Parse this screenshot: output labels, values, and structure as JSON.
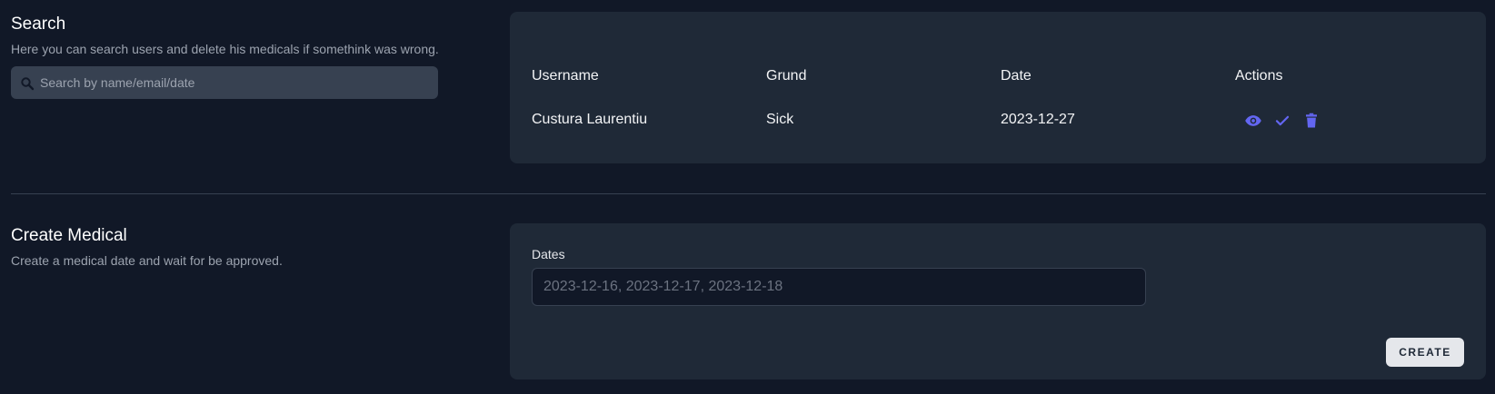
{
  "search_section": {
    "title": "Search",
    "description": "Here you can search users and delete his medicals if somethink was wrong.",
    "search_placeholder": "Search by name/email/date",
    "search_icon": "search-icon"
  },
  "table": {
    "headers": [
      "Username",
      "Grund",
      "Date",
      "Actions"
    ],
    "rows": [
      {
        "username": "Custura Laurentiu",
        "grund": "Sick",
        "date": "2023-12-27"
      }
    ],
    "action_icons": [
      "eye-icon",
      "check-icon",
      "trash-icon"
    ],
    "action_color": "#6366f1"
  },
  "create_section": {
    "title": "Create Medical",
    "description": "Create a medical date and wait for be approved.",
    "dates_label": "Dates",
    "dates_placeholder": "2023-12-16, 2023-12-17, 2023-12-18",
    "create_button": "CREATE"
  },
  "colors": {
    "background": "#111827",
    "card": "#1f2937",
    "accent": "#6366f1"
  }
}
